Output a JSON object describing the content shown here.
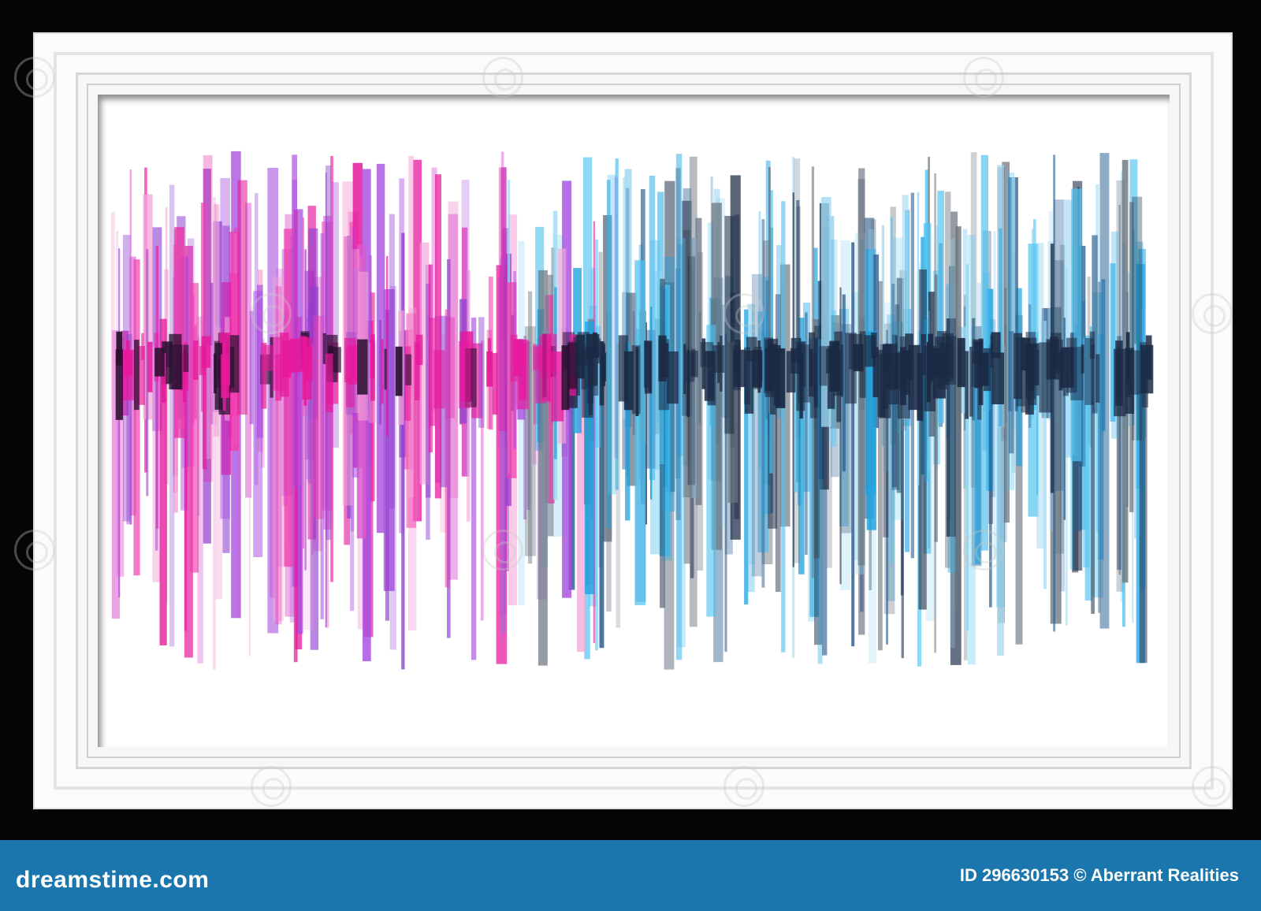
{
  "footer": {
    "brand": "dreamstime.com",
    "credit": "ID 296630153 © Aberrant Realities"
  },
  "colors": {
    "footer_bg": "#1a76ad",
    "magenta": "#e6199b",
    "violet": "#a64be0",
    "blue": "#1fa2e0",
    "navy": "#1b2a44",
    "gray": "#6c7680"
  },
  "artwork": {
    "subject": "sound-waveform-bars",
    "palette_left": "magenta",
    "palette_right": "blue"
  }
}
